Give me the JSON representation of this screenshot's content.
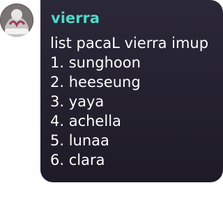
{
  "theme": {
    "bubble_color": "#25222f",
    "sender_color": "#4fd8c8",
    "text_color": "#ffffff"
  },
  "message": {
    "avatar_icon": "user-avatar",
    "sender": "vierra",
    "title_line": "list pacaL vierra imup",
    "list": [
      "1. sunghoon",
      "2. heeseung",
      "3. yaya",
      "4. achella",
      "5. lunaa",
      "6. clara"
    ]
  }
}
